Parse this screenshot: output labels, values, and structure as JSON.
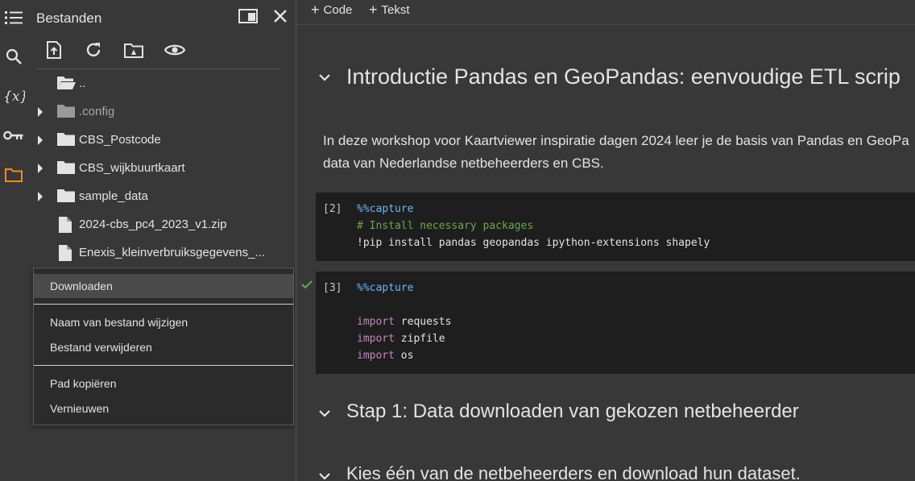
{
  "sidebar": {
    "title": "Bestanden",
    "toolbar": [
      "upload-file-icon",
      "refresh-icon",
      "drive-folder-icon",
      "visibility-icon"
    ]
  },
  "files": [
    {
      "label": "..",
      "type": "folder-open",
      "expandable": false,
      "dim": false
    },
    {
      "label": ".config",
      "type": "folder",
      "expandable": true,
      "dim": true
    },
    {
      "label": "CBS_Postcode",
      "type": "folder",
      "expandable": true,
      "dim": false
    },
    {
      "label": "CBS_wijkbuurtkaart",
      "type": "folder",
      "expandable": true,
      "dim": false
    },
    {
      "label": "sample_data",
      "type": "folder",
      "expandable": true,
      "dim": false
    },
    {
      "label": "2024-cbs_pc4_2023_v1.zip",
      "type": "file",
      "expandable": false,
      "dim": false
    },
    {
      "label": "Enexis_kleinverbruiksgegevens_...",
      "type": "file",
      "expandable": false,
      "dim": false
    }
  ],
  "context_menu": {
    "download": "Downloaden",
    "rename": "Naam van bestand wijzigen",
    "delete": "Bestand verwijderen",
    "copy_path": "Pad kopiëren",
    "refresh": "Vernieuwen"
  },
  "notebook": {
    "add_code": "Code",
    "add_text": "Tekst",
    "heading1": "Introductie Pandas en GeoPandas: eenvoudige ETL scrip",
    "intro_line1": "In deze workshop voor Kaartviewer inspiratie dagen 2024 leer je de basis van Pandas en GeoPa",
    "intro_line2": "data van Nederlandse netbeheerders en CBS.",
    "cell2": {
      "number": "[2]",
      "magic": "%%capture",
      "comment": "# Install necessary packages",
      "command": "!pip install pandas geopandas ipython-extensions shapely"
    },
    "cell3": {
      "number": "[3]",
      "magic": "%%capture",
      "kw1": "import",
      "mod1": " requests",
      "kw2": "import",
      "mod2": " zipfile",
      "kw3": "import",
      "mod3": " os"
    },
    "heading2": "Stap 1: Data downloaden van gekozen netbeheerder",
    "heading3": "Kies één van de netbeheerders en download hun dataset."
  },
  "colors": {
    "background": "#383838",
    "accent_orange": "#f28b22",
    "code_bg": "#1e1e1e",
    "magic_blue": "#6fb5f3",
    "comment_green": "#6aa84f",
    "keyword_purple": "#c586c0"
  }
}
